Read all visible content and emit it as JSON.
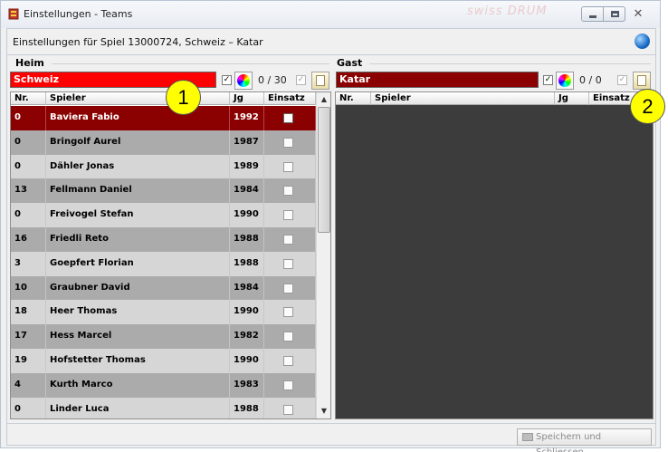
{
  "window": {
    "title": "Einstellungen - Teams",
    "background_ghost_text": "swiss DRUM"
  },
  "header": {
    "label": "Einstellungen für Spiel 13000724, Schweiz – Katar"
  },
  "heim": {
    "legend": "Heim",
    "team_name": "Schweiz",
    "team_color": "#ff0000",
    "checked": true,
    "count": "0 / 30",
    "columns": {
      "nr": "Nr.",
      "spieler": "Spieler",
      "jg": "Jg",
      "einsatz": "Einsatz"
    },
    "players": [
      {
        "nr": "0",
        "name": "Baviera Fabio",
        "jg": "1992",
        "selected": true
      },
      {
        "nr": "0",
        "name": "Bringolf Aurel",
        "jg": "1987"
      },
      {
        "nr": "0",
        "name": "Dähler Jonas",
        "jg": "1989"
      },
      {
        "nr": "13",
        "name": "Fellmann Daniel",
        "jg": "1984"
      },
      {
        "nr": "0",
        "name": "Freivogel Stefan",
        "jg": "1990"
      },
      {
        "nr": "16",
        "name": "Friedli Reto",
        "jg": "1988"
      },
      {
        "nr": "3",
        "name": "Goepfert Florian",
        "jg": "1988"
      },
      {
        "nr": "10",
        "name": "Graubner David",
        "jg": "1984"
      },
      {
        "nr": "18",
        "name": "Heer Thomas",
        "jg": "1990"
      },
      {
        "nr": "17",
        "name": "Hess Marcel",
        "jg": "1982"
      },
      {
        "nr": "19",
        "name": "Hofstetter Thomas",
        "jg": "1990"
      },
      {
        "nr": "4",
        "name": "Kurth Marco",
        "jg": "1983"
      },
      {
        "nr": "0",
        "name": "Linder Luca",
        "jg": "1988"
      }
    ]
  },
  "gast": {
    "legend": "Gast",
    "team_name": "Katar",
    "team_color": "#8b0000",
    "checked": true,
    "count": "0 / 0",
    "columns": {
      "nr": "Nr.",
      "spieler": "Spieler",
      "jg": "Jg",
      "einsatz": "Einsatz"
    }
  },
  "footer": {
    "save_label": "Speichern und Schliessen"
  },
  "callouts": [
    "1",
    "2"
  ],
  "icons": {
    "app": "app-icon",
    "globe": "globe-icon",
    "color_picker": "color-wheel-icon",
    "edit": "edit-icon",
    "printer": "printer-icon"
  },
  "colors": {
    "selected_row": "#8b0000",
    "row_even": "#ababab",
    "row_odd": "#d6d6d6",
    "empty_grid": "#3c3c3c",
    "callout": "#ffff00"
  }
}
